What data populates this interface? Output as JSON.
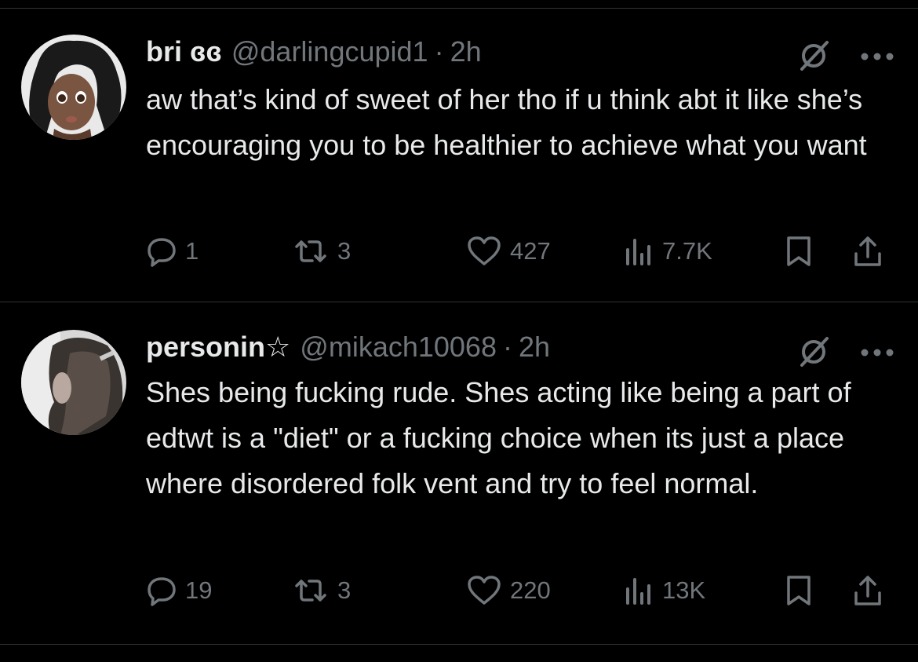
{
  "tweets": [
    {
      "display_name": "bri ɞɞ",
      "handle": "@darlingcupid1",
      "separator": "·",
      "time": "2h",
      "text": "aw that’s kind of sweet of her tho if u think abt it like she’s encouraging you to be healthier to achieve what you want",
      "counts": {
        "replies": "1",
        "reposts": "3",
        "likes": "427",
        "views": "7.7K"
      },
      "avatar_icon": "cartoon-face-avatar"
    },
    {
      "display_name": "personin☆",
      "handle": "@mikach10068",
      "separator": "·",
      "time": "2h",
      "text": "Shes being fucking rude. Shes acting like being a part of edtwt is a \"diet\" or a fucking choice when its just a place where disordered folk vent and try to feel normal.",
      "counts": {
        "replies": "19",
        "reposts": "3",
        "likes": "220",
        "views": "13K"
      },
      "avatar_icon": "photo-avatar"
    }
  ],
  "icons": {
    "top": [
      "grok-icon",
      "more-icon"
    ],
    "actions": [
      "reply-icon",
      "repost-icon",
      "like-icon",
      "views-icon",
      "bookmark-icon",
      "share-icon"
    ]
  },
  "colors": {
    "background": "#000000",
    "text": "#e7e9ea",
    "muted": "#71767b",
    "divider": "#2f3336"
  }
}
